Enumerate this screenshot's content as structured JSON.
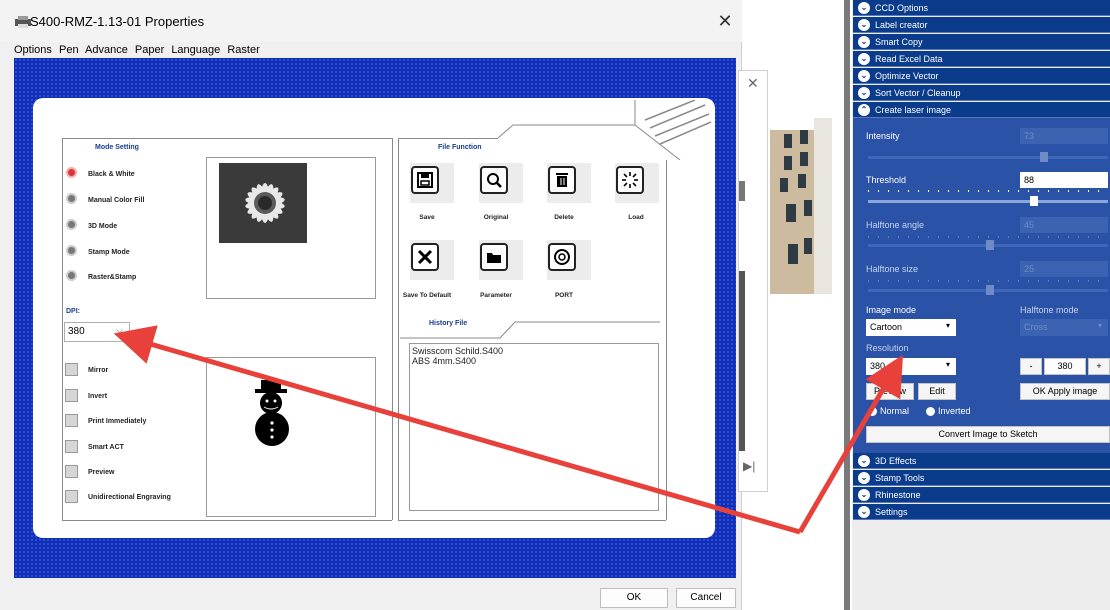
{
  "dialog": {
    "title": "S400-RMZ-1.13-01 Properties",
    "menu": [
      "Options",
      "Pen",
      "Advance",
      "Paper",
      "Language",
      "Raster"
    ],
    "close_label": "✕",
    "mode_setting_title": "Mode Setting",
    "modes": [
      {
        "label": "Black & White",
        "selected": true
      },
      {
        "label": "Manual Color Fill",
        "selected": false
      },
      {
        "label": "3D Mode",
        "selected": false
      },
      {
        "label": "Stamp Mode",
        "selected": false
      },
      {
        "label": "Raster&Stamp",
        "selected": false
      }
    ],
    "dpi_label": "DPI:",
    "dpi_value": "380",
    "options": [
      "Mirror",
      "Invert",
      "Print Immediately",
      "Smart ACT",
      "Preview",
      "Unidirectional Engraving"
    ],
    "file_function_title": "File Function",
    "file_buttons": [
      "Save",
      "Original",
      "Delete",
      "Load",
      "Save To Default",
      "Parameter",
      "PORT"
    ],
    "history_title": "History File",
    "history": [
      "Swisscom Schild.S400",
      "ABS 4mm.S400"
    ],
    "ok_label": "OK",
    "cancel_label": "Cancel"
  },
  "background_window": {
    "close_label": "✕",
    "play_label": "▶|"
  },
  "right_panel": {
    "sections_top": [
      "CCD Options",
      "Label creator",
      "Smart Copy",
      "Read Excel Data",
      "Optimize Vector",
      "Sort Vector / Cleanup"
    ],
    "expanded_section": "Create laser image",
    "intensity_label": "Intensity",
    "intensity_value": "73",
    "threshold_label": "Threshold",
    "threshold_value": "88",
    "halftone_angle_label": "Halftone angle",
    "halftone_angle_value": "45",
    "halftone_size_label": "Halftone size",
    "halftone_size_value": "25",
    "image_mode_label": "Image mode",
    "image_mode_value": "Cartoon",
    "halftone_mode_label": "Halftone mode",
    "halftone_mode_value": "Cross",
    "resolution_label": "Resolution",
    "resolution_value": "380",
    "stepper_minus": "-",
    "stepper_value": "380",
    "stepper_plus": "+",
    "preview_label": "Preview",
    "edit_label": "Edit",
    "ok_apply_label": "OK Apply image",
    "radio_normal": "Normal",
    "radio_inverted": "Inverted",
    "convert_label": "Convert Image to Sketch",
    "sections_bottom": [
      "3D Effects",
      "Stamp Tools",
      "Rhinestone",
      "Settings"
    ]
  },
  "colors": {
    "dialog_blue": "#0f2fb8",
    "section_blue": "#0b3c8c",
    "laser_panel_blue": "#2a52a6",
    "arrow_red": "#e8403a"
  }
}
